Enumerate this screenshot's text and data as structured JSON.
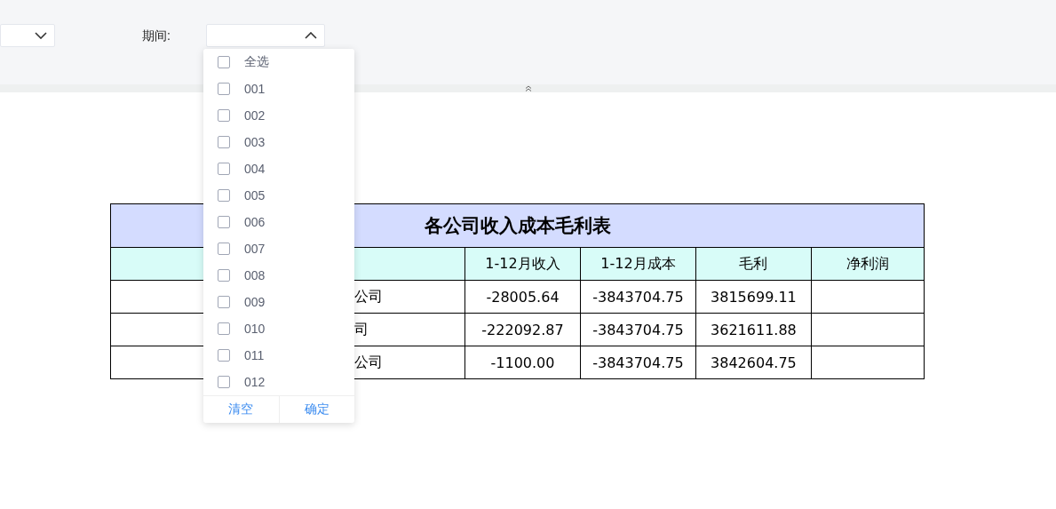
{
  "filter_bar": {
    "company_select": {
      "expanded": false
    },
    "period_select": {
      "label": "期间:",
      "expanded": true,
      "options": [
        {
          "label": "全选",
          "checked": false
        },
        {
          "label": "001",
          "checked": false
        },
        {
          "label": "002",
          "checked": false
        },
        {
          "label": "003",
          "checked": false
        },
        {
          "label": "004",
          "checked": false
        },
        {
          "label": "005",
          "checked": false
        },
        {
          "label": "006",
          "checked": false
        },
        {
          "label": "007",
          "checked": false
        },
        {
          "label": "008",
          "checked": false
        },
        {
          "label": "009",
          "checked": false
        },
        {
          "label": "010",
          "checked": false
        },
        {
          "label": "011",
          "checked": false
        },
        {
          "label": "012",
          "checked": false
        }
      ],
      "buttons": [
        "清空",
        "确定"
      ]
    }
  },
  "table": {
    "title": "各公司收入成本毛利表",
    "columns": [
      "1-12月收入",
      "1-12月成本",
      "毛利",
      "净利润"
    ],
    "rows": [
      {
        "company": "公司",
        "values": [
          "-28005.64",
          "-3843704.75",
          "3815699.11"
        ]
      },
      {
        "company": "司",
        "values": [
          "-222092.87",
          "-3843704.75",
          "3621611.88"
        ]
      },
      {
        "company": "公司",
        "values": [
          "-1100.00",
          "-3843704.75",
          "3842604.75"
        ]
      }
    ]
  }
}
